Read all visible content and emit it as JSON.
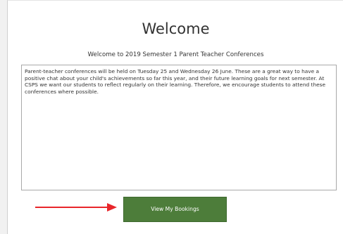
{
  "header": {
    "title": "Welcome",
    "subtitle": "Welcome to 2019 Semester 1 Parent Teacher Conferences"
  },
  "message": {
    "text": "Parent-teacher conferences will be held on Tuesday 25 and Wednesday 26 June.  These are a great way to have a positive chat about your child's achievements so far this year, and their future learning goals for next semester. At CSPS we want our students to reflect regularly on their learning. Therefore, we encourage students to attend these conferences where possible."
  },
  "actions": {
    "view_bookings_label": "View My Bookings"
  },
  "annotation": {
    "arrow_color": "#e8262b"
  },
  "colors": {
    "button": "#4d7d3a",
    "button_text": "#ffffff"
  }
}
